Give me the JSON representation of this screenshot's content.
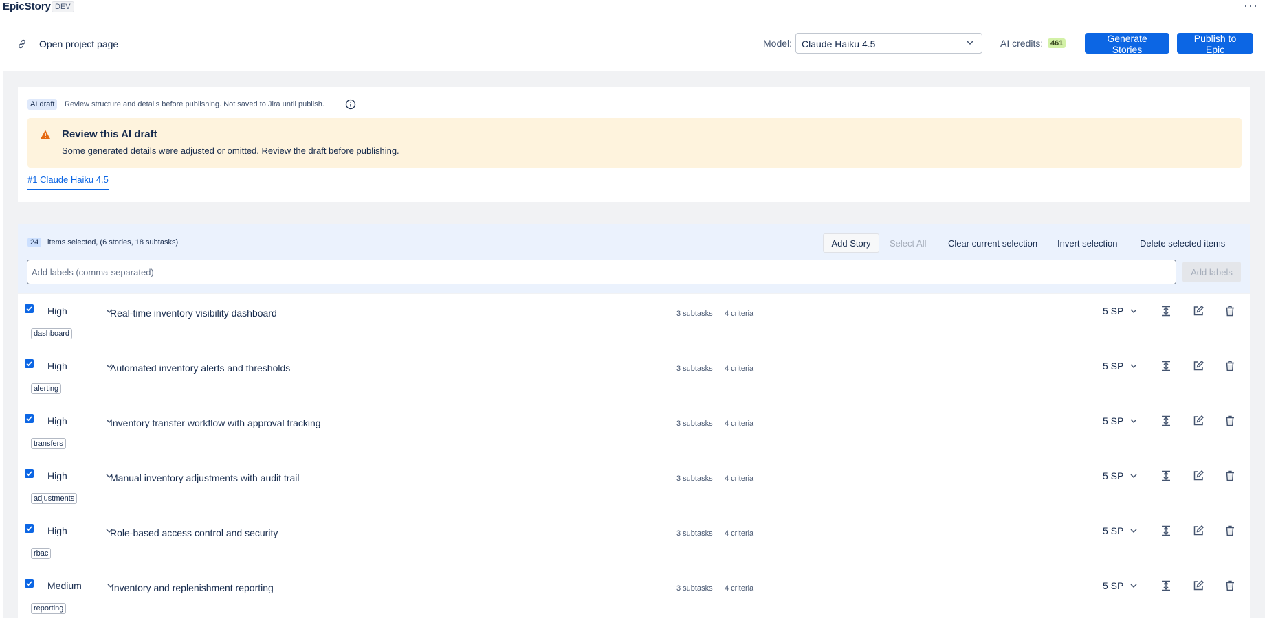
{
  "app": {
    "title": "EpicStory",
    "env": "DEV",
    "more_glyph": "···"
  },
  "header": {
    "open_project": "Open project page",
    "model_label": "Model:",
    "model_value": "Claude Haiku 4.5",
    "credits_label": "AI credits:",
    "credits_value": "461",
    "generate_label": "Generate Stories",
    "publish_label": "Publish to Epic"
  },
  "draft": {
    "badge": "AI draft",
    "note": "Review structure and details before publishing. Not saved to Jira until publish.",
    "warning_title": "Review this AI draft",
    "warning_text": "Some generated details were adjusted or omitted. Review the draft before publishing.",
    "tab_label": "#1 Claude Haiku 4.5"
  },
  "selection": {
    "count": "24",
    "text": "items selected, (6 stories, 18 subtasks)",
    "add_story": "Add Story",
    "select_all": "Select All",
    "clear": "Clear current selection",
    "invert": "Invert selection",
    "delete": "Delete selected items",
    "labels_placeholder": "Add labels (comma-separated)",
    "add_labels": "Add labels"
  },
  "stories": [
    {
      "checked": true,
      "priority": "High",
      "title": "Real-time inventory visibility dashboard",
      "subtasks": "3 subtasks",
      "criteria": "4 criteria",
      "sp": "5 SP",
      "label": "dashboard"
    },
    {
      "checked": true,
      "priority": "High",
      "title": "Automated inventory alerts and thresholds",
      "subtasks": "3 subtasks",
      "criteria": "4 criteria",
      "sp": "5 SP",
      "label": "alerting"
    },
    {
      "checked": true,
      "priority": "High",
      "title": "Inventory transfer workflow with approval tracking",
      "subtasks": "3 subtasks",
      "criteria": "4 criteria",
      "sp": "5 SP",
      "label": "transfers"
    },
    {
      "checked": true,
      "priority": "High",
      "title": "Manual inventory adjustments with audit trail",
      "subtasks": "3 subtasks",
      "criteria": "4 criteria",
      "sp": "5 SP",
      "label": "adjustments"
    },
    {
      "checked": true,
      "priority": "High",
      "title": "Role-based access control and security",
      "subtasks": "3 subtasks",
      "criteria": "4 criteria",
      "sp": "5 SP",
      "label": "rbac"
    },
    {
      "checked": true,
      "priority": "Medium",
      "title": "Inventory and replenishment reporting",
      "subtasks": "3 subtasks",
      "criteria": "4 criteria",
      "sp": "5 SP",
      "label": "reporting"
    }
  ],
  "colors": {
    "primary": "#0c66e4",
    "warning_bg": "#fef3dd",
    "warning_icon": "#e56910",
    "selection_bg": "#ebf2fd",
    "credits_bg": "#d3f1a7"
  }
}
